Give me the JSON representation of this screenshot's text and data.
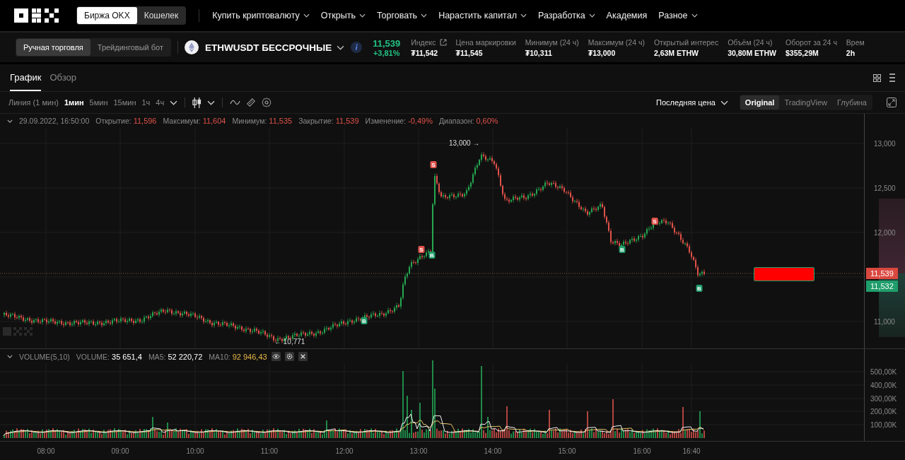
{
  "nav": {
    "exchange_tabs": [
      {
        "label": "Биржа OKX",
        "selected": true
      },
      {
        "label": "Кошелек",
        "selected": false
      }
    ],
    "menu": [
      {
        "label": "Купить криптовалюту",
        "dropdown": true
      },
      {
        "label": "Открыть",
        "dropdown": true
      },
      {
        "label": "Торговать",
        "dropdown": true
      },
      {
        "label": "Нарастить капитал",
        "dropdown": true
      },
      {
        "label": "Разработка",
        "dropdown": true
      },
      {
        "label": "Академия",
        "dropdown": false
      },
      {
        "label": "Разное",
        "dropdown": true
      }
    ]
  },
  "ticker": {
    "mode_tabs": [
      {
        "label": "Ручная торговля",
        "selected": true
      },
      {
        "label": "Трейдинговый бот",
        "selected": false
      }
    ],
    "pair": "ETHWUSDT БЕССРОЧНЫЕ",
    "last_price": "11,539",
    "change": "+3,81%",
    "stats": [
      {
        "label": "Индекс",
        "value": "₮11,542",
        "external_link": true
      },
      {
        "label": "Цена маркировки",
        "value": "₮11,545",
        "external_link": false
      },
      {
        "label": "Минимум (24 ч)",
        "value": "₮10,311",
        "external_link": false
      },
      {
        "label": "Максимум (24 ч)",
        "value": "₮13,000",
        "external_link": false
      },
      {
        "label": "Открытый интерес",
        "value": "2,63M ETHW",
        "external_link": false
      },
      {
        "label": "Объём (24 ч)",
        "value": "30,80M ETHW",
        "external_link": false
      },
      {
        "label": "Оборот за 24 ч",
        "value": "$355,29M",
        "external_link": false
      },
      {
        "label": "Врем",
        "value": "2h",
        "external_link": false
      }
    ]
  },
  "view_tabs": [
    {
      "label": "График",
      "selected": true
    },
    {
      "label": "Обзор",
      "selected": false
    }
  ],
  "toolbar": {
    "intervals": [
      {
        "label": "Линия (1 мин)",
        "selected": false
      },
      {
        "label": "1мин",
        "selected": true
      },
      {
        "label": "5мин",
        "selected": false
      },
      {
        "label": "15мин",
        "selected": false
      },
      {
        "label": "1ч",
        "selected": false
      },
      {
        "label": "4ч",
        "selected": false
      }
    ],
    "price_type": "Последняя цена",
    "chart_modes": [
      {
        "label": "Original",
        "selected": true
      },
      {
        "label": "TradingView",
        "selected": false
      },
      {
        "label": "Глубина",
        "selected": false
      }
    ]
  },
  "ohlc": {
    "datetime": "29.09.2022, 16:50:00",
    "fields": [
      {
        "label": "Открытие:",
        "value": "11,596"
      },
      {
        "label": "Максимум:",
        "value": "11,604"
      },
      {
        "label": "Минимум:",
        "value": "11,535"
      },
      {
        "label": "Закрытие:",
        "value": "11,539"
      },
      {
        "label": "Изменение:",
        "value": "-0,49%"
      },
      {
        "label": "Диапазон:",
        "value": "0,60%"
      }
    ]
  },
  "chart": {
    "price_ticks": [
      "13,000",
      "12,500",
      "12,000",
      "11,000"
    ],
    "high_note": "13,000 →",
    "low_note": "← 10,771",
    "last_price_tag": "11,539",
    "mark_price_tag": "11,532",
    "trade_markers": [
      {
        "label": "S",
        "kind": "sell"
      },
      {
        "label": "S",
        "kind": "sell"
      },
      {
        "label": "B",
        "kind": "buy"
      },
      {
        "label": "B",
        "kind": "buy"
      },
      {
        "label": "B",
        "kind": "buy"
      },
      {
        "label": "S",
        "kind": "sell"
      },
      {
        "label": "B",
        "kind": "buy"
      }
    ]
  },
  "volume": {
    "title": "VOLUME(5,10)",
    "fields": [
      {
        "label": "VOLUME:",
        "value": "35 651,4",
        "kind": "plain"
      },
      {
        "label": "MA5:",
        "value": "52 220,72",
        "kind": "plain"
      },
      {
        "label": "MA10:",
        "value": "92 946,43",
        "kind": "ma10"
      }
    ],
    "ticks": [
      "500,00K",
      "400,00K",
      "300,00K",
      "200,00K",
      "100,00K"
    ]
  },
  "time_axis": [
    "08:00",
    "09:00",
    "10:00",
    "11:00",
    "12:00",
    "13:00",
    "14:00",
    "15:00",
    "16:00",
    "16:40"
  ]
}
